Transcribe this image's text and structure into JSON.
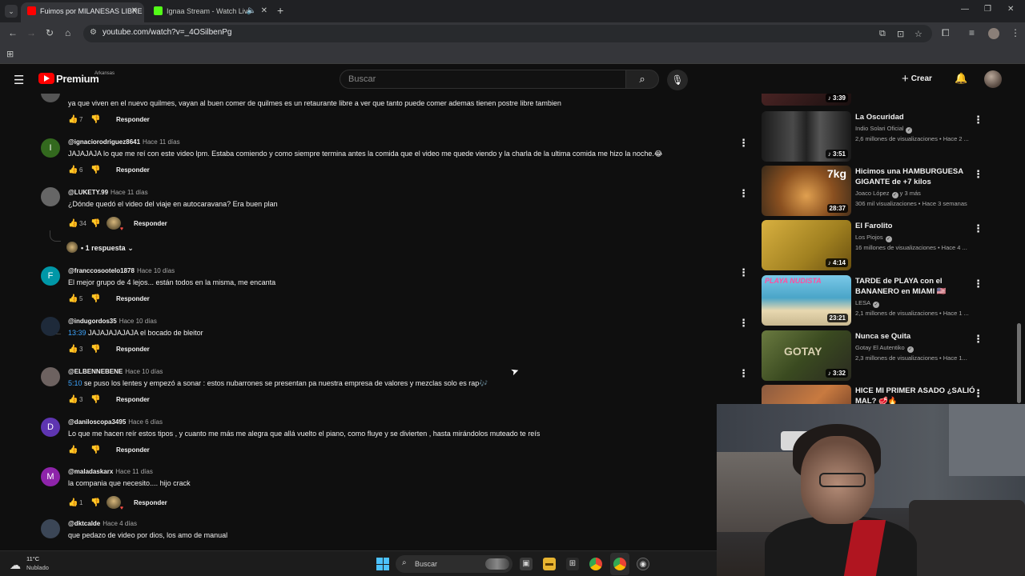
{
  "browser": {
    "tabs": [
      {
        "title": "Fuimos por MILANESAS LIBRE",
        "active": true,
        "favicon_color": "#ff0000"
      },
      {
        "title": "Ignaa Stream - Watch Live",
        "active": false,
        "favicon_color": "#53fc18"
      }
    ],
    "url": "youtube.com/watch?v=_4OSilbenPg"
  },
  "youtube": {
    "brand": "Premium",
    "country": "Arkansas",
    "search_placeholder": "Buscar",
    "create_label": "Crear"
  },
  "comments": [
    {
      "author": "",
      "date": "",
      "text": "ya que viven en el nuevo quilmes, vayan al buen comer de quilmes es un retaurante libre a ver que tanto puede comer ademas tienen postre libre tambien",
      "likes": "7",
      "reply_label": "Responder",
      "avatar_letter": "",
      "avatar_color": "#555555"
    },
    {
      "author": "@ignaciorodriguez8641",
      "date": "Hace 11 días",
      "text": "JAJAJAJA lo que me reí con este video lpm. Estaba comiendo y como siempre termina antes la comida que el video me quede viendo y la charla de la ultima comida me hizo la noche.😂",
      "likes": "6",
      "reply_label": "Responder",
      "avatar_letter": "I",
      "avatar_color": "#33691e"
    },
    {
      "author": "@LUKETY.99",
      "date": "Hace 11 días",
      "text": "¿Dónde quedó el video del viaje en autocaravana? Era buen plan",
      "likes": "34",
      "reply_label": "Responder",
      "avatar_letter": "",
      "avatar_color": "#666666",
      "replies_label": "• 1 respuesta"
    },
    {
      "author": "@franccosootelo1878",
      "date": "Hace 10 días",
      "text": "El mejor grupo de 4 lejos... están todos en la misma, me encanta",
      "likes": "5",
      "reply_label": "Responder",
      "avatar_letter": "F",
      "avatar_color": "#0097a7"
    },
    {
      "author": "@indugordos35",
      "date": "Hace 10 días",
      "timestamp": "13:39",
      "text": " JAJAJAJAJAJA el bocado de bleitor",
      "likes": "3",
      "reply_label": "Responder",
      "avatar_letter": "",
      "avatar_color": "#1e2a3a"
    },
    {
      "author": "@ELBENNEBENE",
      "date": "Hace 10 días",
      "timestamp": "5:10",
      "text": " se puso los lentes y empezó a sonar : estos nubarrones se presentan pa nuestra empresa de valores y mezclas solo es rap🎶",
      "likes": "3",
      "reply_label": "Responder",
      "avatar_letter": "",
      "avatar_color": "#6d6260"
    },
    {
      "author": "@daniloscopa3495",
      "date": "Hace 6 días",
      "text": "Lo que me hacen reír estos tipos , y cuanto me más me alegra que allá vuelto el piano, como fluye y se divierten , hasta mirándolos muteado te reís",
      "likes": "",
      "reply_label": "Responder",
      "avatar_letter": "D",
      "avatar_color": "#5e35b1"
    },
    {
      "author": "@maladaskarx",
      "date": "Hace 11 días",
      "text": "la compania que necesito.... hijo crack",
      "likes": "1",
      "reply_label": "Responder",
      "avatar_letter": "M",
      "avatar_color": "#8e24aa"
    },
    {
      "author": "@dktcalde",
      "date": "Hace 4 días",
      "text": "que pedazo de video por dios, los amo de manual",
      "likes": "",
      "reply_label": "",
      "avatar_letter": "",
      "avatar_color": "#3b4656"
    }
  ],
  "sidebar": [
    {
      "title": "",
      "channel": "",
      "meta": "",
      "duration": "3:39",
      "music": true,
      "thumb_color": "#3a2020"
    },
    {
      "title": "La Oscuridad",
      "channel": "Indio Solari Oficial",
      "verified": true,
      "meta": "2,6 millones de visualizaciones • Hace 2 ...",
      "duration": "3:51",
      "music": true,
      "thumb_color": "#2a2a2a"
    },
    {
      "title": "Hicimos una HAMBURGUESA GIGANTE de +7 kilos",
      "channel": "Joaco López",
      "verified": true,
      "channel_extra": "y 3 más",
      "meta": "306 mil visualizaciones • Hace 3 semanas",
      "duration": "28:37",
      "music": false,
      "thumb_color": "#c98a3c",
      "thumb_label": "7kg"
    },
    {
      "title": "El Farolito",
      "channel": "Los Piojos",
      "verified": true,
      "meta": "16 millones de visualizaciones • Hace 4 ...",
      "duration": "4:14",
      "music": true,
      "thumb_color": "#c9a83a"
    },
    {
      "title": "TARDE de PLAYA con el BANANERO en MIAMI 🇺🇸",
      "channel": "LESA",
      "verified": true,
      "meta": "2,1 millones de visualizaciones • Hace 1 ...",
      "duration": "23:21",
      "music": false,
      "thumb_color": "#4aa5c8",
      "thumb_label": "PLAYA NUDISTA"
    },
    {
      "title": "Nunca se Quita",
      "channel": "Gotay El Autentiko",
      "verified": true,
      "meta": "2,3 millones de visualizaciones • Hace 1...",
      "duration": "3:32",
      "music": true,
      "thumb_color": "#4a5a30",
      "thumb_label": "GOTAY"
    },
    {
      "title": "HICE MI PRIMER ASADO ¿SALIÓ MAL? 🥩🔥",
      "channel": "",
      "meta": "",
      "duration": "",
      "music": false,
      "thumb_color": "#7a4a30"
    }
  ],
  "taskbar": {
    "temperature": "11°C",
    "weather": "Nublado",
    "search_label": "Buscar"
  }
}
